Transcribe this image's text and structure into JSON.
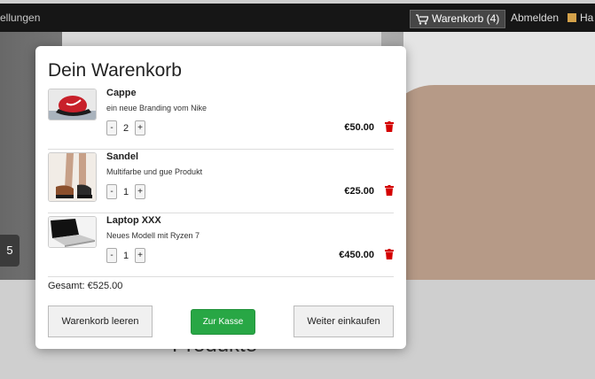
{
  "navbar": {
    "left_text": "ellungen",
    "cart_label": "Warenkorb (4)",
    "logout_label": "Abmelden",
    "more_label": "Ha"
  },
  "hero": {
    "shirt_text": "...",
    "badge": "5"
  },
  "section": {
    "title": "Produkte"
  },
  "cart": {
    "title": "Dein Warenkorb",
    "items": [
      {
        "name": "Cappe",
        "description": "ein neue Branding vom Nike",
        "quantity": "2",
        "price": "€50.00",
        "image": "cap-image"
      },
      {
        "name": "Sandel",
        "description": "Multifarbe und gue Produkt",
        "quantity": "1",
        "price": "€25.00",
        "image": "sandal-image"
      },
      {
        "name": "Laptop XXX",
        "description": "Neues Modell mit Ryzen 7",
        "quantity": "1",
        "price": "€450.00",
        "image": "laptop-image"
      }
    ],
    "minus_label": "-",
    "plus_label": "+",
    "total": "Gesamt: €525.00",
    "buttons": {
      "clear": "Warenkorb leeren",
      "checkout": "Zur Kasse",
      "continue": "Weiter einkaufen"
    }
  },
  "colors": {
    "checkout": "#28a745",
    "trash": "#d40000",
    "navbar": "#161616"
  }
}
